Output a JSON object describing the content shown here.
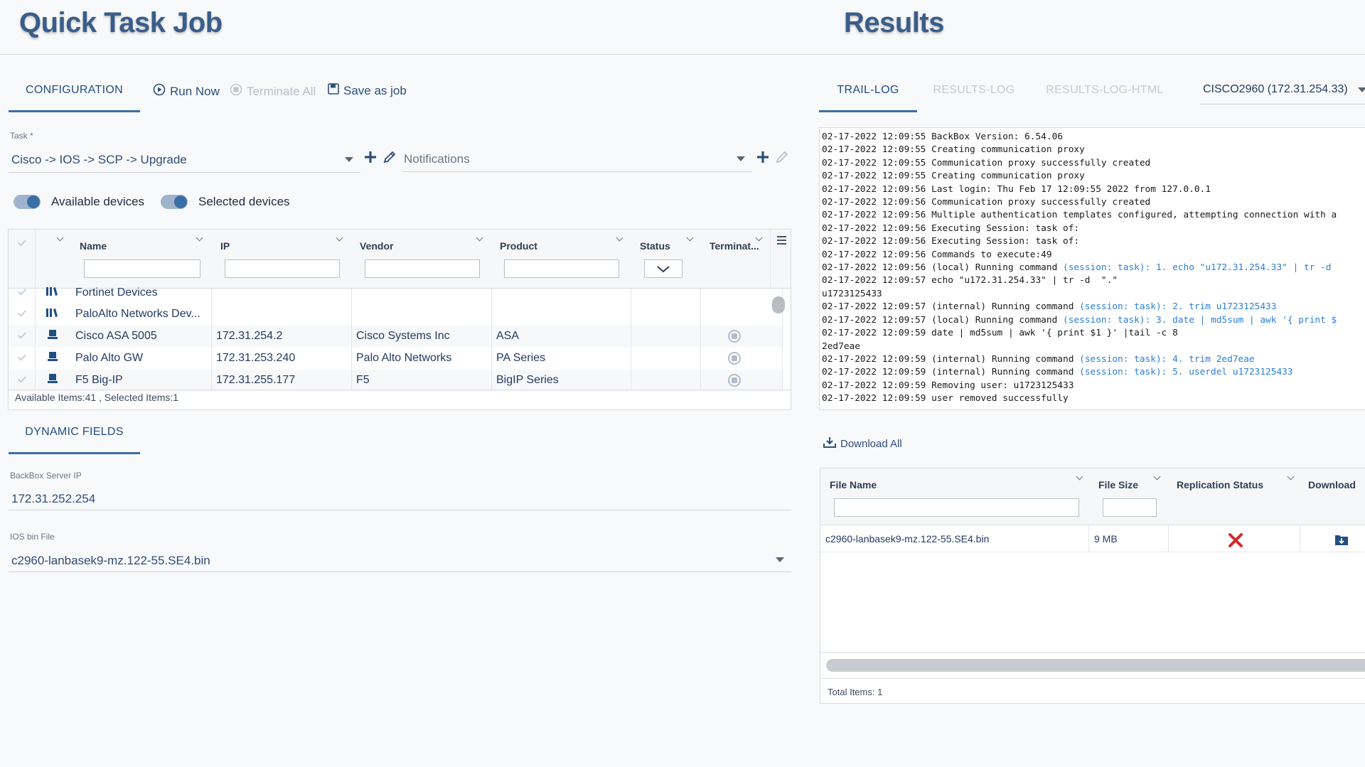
{
  "left_title": "Quick Task Job",
  "right_title": "Results",
  "config": {
    "tab_configuration": "CONFIGURATION",
    "run_now": "Run Now",
    "terminate_all": "Terminate All",
    "save_as_job": "Save as job",
    "task_label": "Task *",
    "task_value": "Cisco -> IOS -> SCP -> Upgrade",
    "notifications_placeholder": "Notifications",
    "available_devices": "Available devices",
    "selected_devices": "Selected devices"
  },
  "devices_grid": {
    "columns": [
      "Name",
      "IP",
      "Vendor",
      "Product",
      "Status",
      "Terminat..."
    ],
    "rows": [
      {
        "type": "group",
        "name": "Fortinet Devices",
        "ip": "",
        "vendor": "",
        "product": "",
        "terminate": false
      },
      {
        "type": "group",
        "name": "PaloAlto Networks Dev...",
        "ip": "",
        "vendor": "",
        "product": "",
        "terminate": false
      },
      {
        "type": "device",
        "name": "Cisco ASA 5005",
        "ip": "172.31.254.2",
        "vendor": "Cisco Systems Inc",
        "product": "ASA",
        "terminate": true
      },
      {
        "type": "device",
        "name": "Palo Alto GW",
        "ip": "172.31.253.240",
        "vendor": "Palo Alto Networks",
        "product": "PA Series",
        "terminate": true
      },
      {
        "type": "device",
        "name": "F5 Big-IP",
        "ip": "172.31.255.177",
        "vendor": "F5",
        "product": "BigIP Series",
        "terminate": true
      }
    ],
    "footer": "Available Items:41 , Selected Items:1"
  },
  "dynamic_fields": {
    "tab_label": "DYNAMIC FIELDS",
    "server_ip_label": "BackBox Server IP",
    "server_ip_value": "172.31.252.254",
    "ios_bin_label": "IOS bin File",
    "ios_bin_value": "c2960-lanbasek9-mz.122-55.SE4.bin"
  },
  "results": {
    "tabs": [
      "TRAIL-LOG",
      "RESULTS-LOG",
      "RESULTS-LOG-HTML"
    ],
    "device_select": "CISCO2960 (172.31.254.33)",
    "log_lines": [
      {
        "text": "02-17-2022 12:09:55 BackBox Version: 6.54.06",
        "hl": ""
      },
      {
        "text": "02-17-2022 12:09:55 Creating communication proxy",
        "hl": ""
      },
      {
        "text": "02-17-2022 12:09:55 Communication proxy successfully created",
        "hl": ""
      },
      {
        "text": "02-17-2022 12:09:55 Creating communication proxy",
        "hl": ""
      },
      {
        "text": "02-17-2022 12:09:56 Last login: Thu Feb 17 12:09:55 2022 from 127.0.0.1",
        "hl": ""
      },
      {
        "text": "02-17-2022 12:09:56 Communication proxy successfully created",
        "hl": ""
      },
      {
        "text": "02-17-2022 12:09:56 Multiple authentication templates configured, attempting connection with a",
        "hl": ""
      },
      {
        "text": "02-17-2022 12:09:56 Executing Session: task of:",
        "hl": ""
      },
      {
        "text": "02-17-2022 12:09:56 Executing Session: task of:",
        "hl": ""
      },
      {
        "text": "02-17-2022 12:09:56 Commands to execute:49",
        "hl": ""
      },
      {
        "text": "02-17-2022 12:09:56 (local) Running command ",
        "hl": "(session: task): 1. echo \"u172.31.254.33\" | tr -d"
      },
      {
        "text": "02-17-2022 12:09:57 echo \"u172.31.254.33\" | tr -d  \".\"",
        "hl": ""
      },
      {
        "text": "u1723125433",
        "hl": ""
      },
      {
        "text": "02-17-2022 12:09:57 (internal) Running command ",
        "hl": "(session: task): 2. trim u1723125433"
      },
      {
        "text": "02-17-2022 12:09:57 (local) Running command ",
        "hl": "(session: task): 3. date | md5sum | awk '{ print $"
      },
      {
        "text": "02-17-2022 12:09:59 date | md5sum | awk '{ print $1 }' |tail -c 8",
        "hl": ""
      },
      {
        "text": "2ed7eae",
        "hl": ""
      },
      {
        "text": "02-17-2022 12:09:59 (internal) Running command ",
        "hl": "(session: task): 4. trim 2ed7eae"
      },
      {
        "text": "02-17-2022 12:09:59 (internal) Running command ",
        "hl": "(session: task): 5. userdel u1723125433"
      },
      {
        "text": "02-17-2022 12:09:59 Removing user: u1723125433",
        "hl": ""
      },
      {
        "text": "02-17-2022 12:09:59 user removed successfully",
        "hl": ""
      }
    ],
    "download_all": "Download All",
    "files_columns": [
      "File Name",
      "File Size",
      "Replication Status",
      "Download"
    ],
    "files": [
      {
        "name": "c2960-lanbasek9-mz.122-55.SE4.bin",
        "size": "9 MB",
        "replication_status": "failed"
      }
    ],
    "files_footer": "Total Items: 1"
  },
  "colors": {
    "accent": "#3a6ea5",
    "title": "#3a5d8a",
    "highlight": "#2a7fd4",
    "error": "#d42a2a"
  }
}
